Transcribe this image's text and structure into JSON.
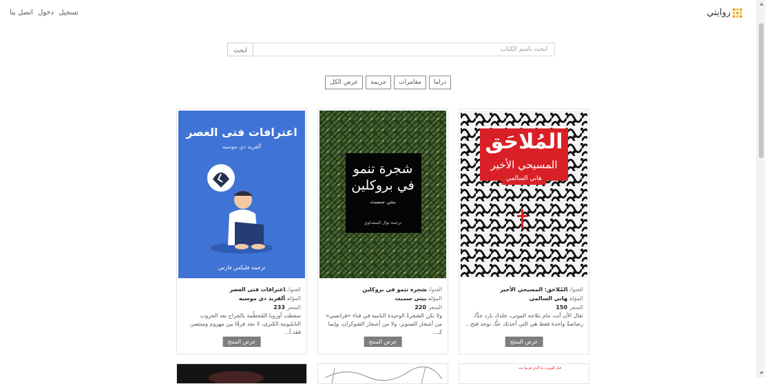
{
  "nav": {
    "register": "تسجيل",
    "login": "دخول",
    "contact": "اتصل بنا"
  },
  "brand": {
    "name": "روايتي"
  },
  "search": {
    "placeholder": "ابحث باسم الكتاب",
    "button": "ابحث"
  },
  "filters": [
    "دراما",
    "مغامرات",
    "جريمة",
    "عرض الكل"
  ],
  "labels": {
    "title": "العنوان",
    "author": "المؤلف",
    "price": "السعر",
    "show_product": "عرض المنتج"
  },
  "books": [
    {
      "cover_title": "المُلاحَق",
      "cover_subtitle": "المسيحي الأخير",
      "cover_author": "هاني السالمي",
      "title": "المُلاحَق: المسيحي الأخير",
      "author": "هاني السالمي",
      "price": "150",
      "description": "تقال الآن أنت تنام بثلاجة الموتى، جلدك بارد جدًّا، رصاصةٌ واحدة فقط هي التي أخذتك عنًّا، توجد فتح..."
    },
    {
      "cover_title": "شجرة تنمو",
      "cover_title2": "في بروكلين",
      "cover_author": "بيتي سميث",
      "cover_translator": "ترجمة نوال السعداوي",
      "title": "شجرة تنمو في بروكلين",
      "author": "بيتي سميث",
      "price": "220",
      "description": "ولا تكن الشجرةُ الوحيدة النامية في فناء «فرانسي» من أشجار الصنوبر، ولا من أشجار الشوكران، وإنما كـ..."
    },
    {
      "cover_title": "اعترافات فتى العصر",
      "cover_author": "ألفريد دي موسيه",
      "cover_translator": "ترجمة فليكس فارس",
      "title": "اعترافات فتى العصر",
      "author": "ألفريد دي موسيه",
      "price": "233",
      "description": "سقطت أوروبا المُحطّمة بالجراح بعد الحروب النابليونية الكبرى، لا نجد فرقًا بين مهزوم ومنتصر، فقد أ..."
    }
  ],
  "partial_cover_text": "قبل الهروب ما الذي هربوا منه"
}
